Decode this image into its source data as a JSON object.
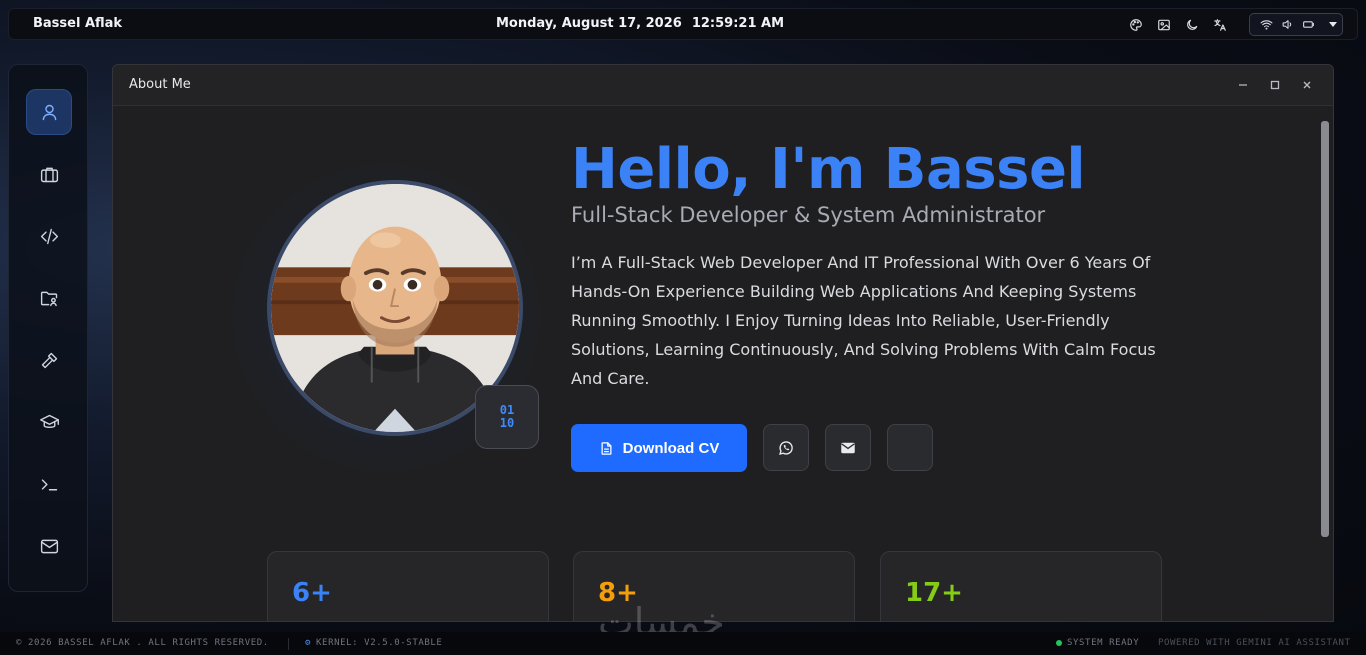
{
  "topbar": {
    "brand": "Bassel Aflak",
    "date": "Monday, August 17, 2026",
    "time": "12:59:21 AM",
    "tray_icons": [
      "palette-icon",
      "image-icon",
      "moon-icon",
      "translate-icon"
    ],
    "system_icons": [
      "wifi-icon",
      "volume-icon",
      "battery-icon",
      "chevron-down-icon"
    ]
  },
  "dock": {
    "items": [
      {
        "name": "about",
        "icon": "user-icon",
        "active": true
      },
      {
        "name": "experience",
        "icon": "briefcase-icon",
        "active": false
      },
      {
        "name": "projects",
        "icon": "code-icon",
        "active": false
      },
      {
        "name": "files",
        "icon": "folder-user-icon",
        "active": false
      },
      {
        "name": "skills",
        "icon": "hammer-icon",
        "active": false
      },
      {
        "name": "education",
        "icon": "graduation-cap-icon",
        "active": false
      },
      {
        "name": "terminal",
        "icon": "terminal-icon",
        "active": false
      },
      {
        "name": "contact",
        "icon": "mail-icon",
        "active": false
      }
    ]
  },
  "window": {
    "title": "About Me",
    "hero": {
      "greeting": "Hello, I'm Bassel",
      "subtitle": "Full-Stack Developer & System Administrator",
      "description": "I’m A Full-Stack Web Developer And IT Professional With Over 6 Years Of Hands-On Experience Building Web Applications And Keeping Systems Running Smoothly. I Enjoy Turning Ideas Into Reliable, User-Friendly Solutions, Learning Continuously, And Solving Problems With Calm Focus And Care.",
      "badge_line1": "01",
      "badge_line2": "10",
      "cv_button": "Download CV",
      "social_icons": [
        "whatsapp-icon",
        "mail-icon",
        "blank"
      ]
    },
    "stats": [
      {
        "value": "6+",
        "color": "#3b82f6"
      },
      {
        "value": "8+",
        "color": "#f59e0b"
      },
      {
        "value": "17+",
        "color": "#84cc16"
      }
    ]
  },
  "footer": {
    "copyright": "© 2026 BASSEL AFLAK . ALL RIGHTS RESERVED.",
    "kernel": "KERNEL: V2.5.0-STABLE",
    "status": "SYSTEM READY",
    "powered": "POWERED WITH GEMINI AI ASSISTANT"
  },
  "watermark": "خمسات"
}
